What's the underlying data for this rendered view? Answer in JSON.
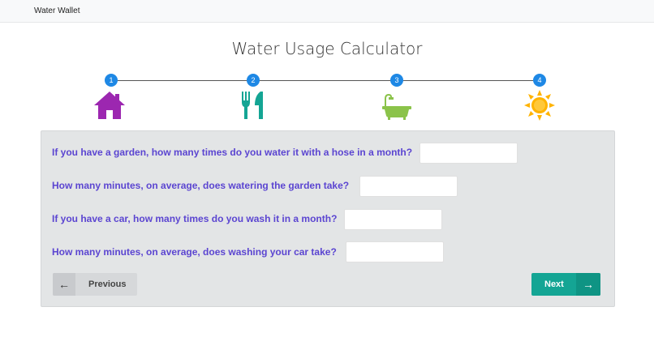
{
  "navbar": {
    "brand": "Water Wallet"
  },
  "page": {
    "title": "Water Usage Calculator"
  },
  "steps": [
    {
      "number": "1",
      "icon": "house-icon",
      "color": "#9c27b0"
    },
    {
      "number": "2",
      "icon": "utensils-icon",
      "color": "#14a594"
    },
    {
      "number": "3",
      "icon": "bathtub-icon",
      "color": "#8bc34a"
    },
    {
      "number": "4",
      "icon": "sun-icon",
      "color": "#ffb300"
    }
  ],
  "questions": [
    {
      "label": "If you have a garden, how many times do you water it with a hose in a month?",
      "value": ""
    },
    {
      "label": "How many minutes, on average, does watering the garden take?",
      "value": ""
    },
    {
      "label": "If you have a car, how many times do you wash it in a month?",
      "value": ""
    },
    {
      "label": "How many minutes, on average, does washing your car take?",
      "value": ""
    }
  ],
  "buttons": {
    "previous": "Previous",
    "next": "Next"
  },
  "colors": {
    "accent": "#14a594",
    "step": "#1e88e5",
    "question": "#5b45d1"
  }
}
